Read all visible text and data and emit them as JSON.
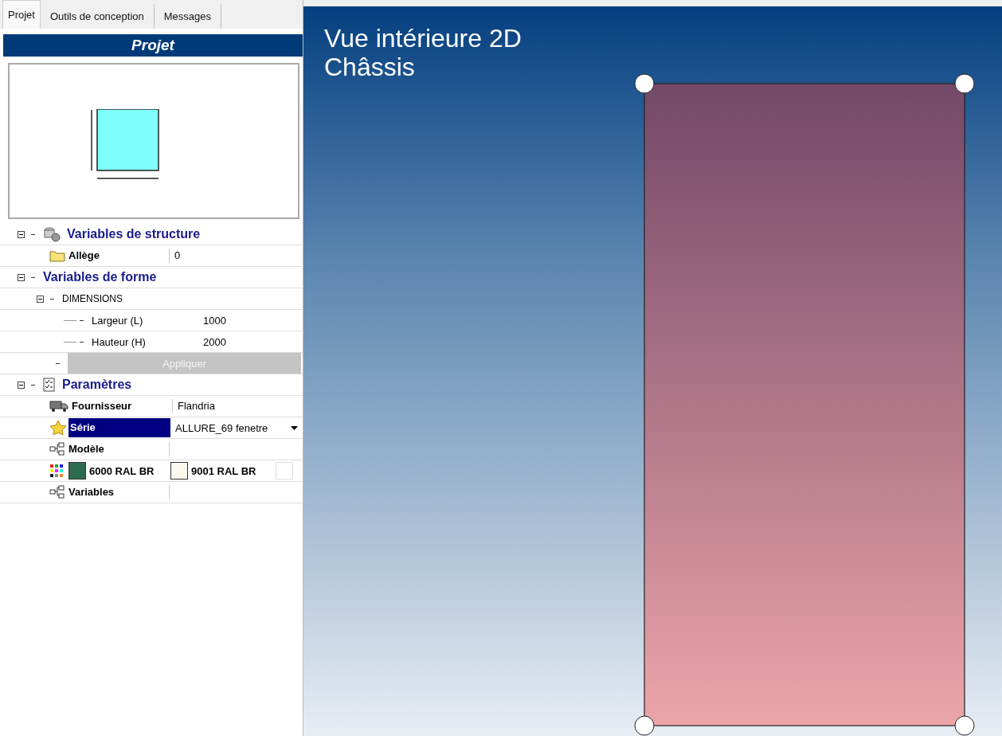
{
  "tabs": [
    {
      "label": "Projet",
      "selected": true
    },
    {
      "label": "Outils de conception",
      "selected": false
    },
    {
      "label": "Messages",
      "selected": false
    }
  ],
  "panel_title": "Projet",
  "sections": [
    {
      "title": "Variables de structure",
      "expanded": true,
      "rows": [
        {
          "kind": "property",
          "label": "Allège",
          "value": "0",
          "selected": false
        }
      ]
    },
    {
      "title": "Variables de forme",
      "expanded": true,
      "rows": [
        {
          "kind": "group",
          "label": "DIMENSIONS",
          "expanded": true,
          "children": [
            {
              "label": "Largeur (L)",
              "value": "1000"
            },
            {
              "label": "Hauteur (H)",
              "value": "2000"
            }
          ]
        },
        {
          "kind": "button",
          "label": "Appliquer",
          "disabled": true
        }
      ]
    },
    {
      "title": "Paramètres",
      "expanded": true,
      "rows": [
        {
          "kind": "property",
          "label": "Fournisseur",
          "value": "Flandria",
          "selected": false
        },
        {
          "kind": "dropdown",
          "label": "Série",
          "value": "ALLURE_69 fenetre",
          "selected": true
        },
        {
          "kind": "property",
          "label": "Modèle",
          "selected": false
        },
        {
          "kind": "colors",
          "colors": [
            {
              "label": "6000 RAL BR",
              "color": "#2e6b4e"
            },
            {
              "label": "9001 RAL BR",
              "color": "#fbf8ee"
            }
          ]
        },
        {
          "kind": "property",
          "label": "Variables",
          "selected": false
        }
      ]
    }
  ],
  "view": {
    "title": "Vue intérieure 2D",
    "subtitle": "Châssis"
  }
}
